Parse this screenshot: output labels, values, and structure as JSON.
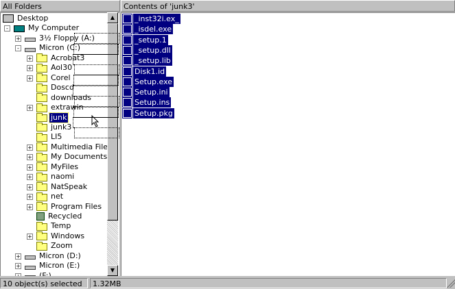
{
  "left_pane": {
    "header": "All Folders"
  },
  "right_pane": {
    "header": "Contents of 'junk3'"
  },
  "tree": {
    "items": [
      {
        "label": "Desktop",
        "icon": "desktop-icon",
        "level": 0,
        "expander": ""
      },
      {
        "label": "My Computer",
        "icon": "computer-icon",
        "level": 1,
        "expander": "-"
      },
      {
        "label": "3½ Floppy (A:)",
        "icon": "floppy-drive-icon",
        "level": 2,
        "expander": "+"
      },
      {
        "label": "Micron (C:)",
        "icon": "hard-drive-icon",
        "level": 2,
        "expander": "-"
      },
      {
        "label": "Acrobat3",
        "icon": "folder-icon",
        "level": 3,
        "expander": "+"
      },
      {
        "label": "Aol30",
        "icon": "folder-icon",
        "level": 3,
        "expander": "+"
      },
      {
        "label": "Corel",
        "icon": "folder-icon",
        "level": 3,
        "expander": "+"
      },
      {
        "label": "Doscd",
        "icon": "folder-icon",
        "level": 3,
        "expander": ""
      },
      {
        "label": "downloads",
        "icon": "folder-icon",
        "level": 3,
        "expander": ""
      },
      {
        "label": "extrawin",
        "icon": "folder-icon",
        "level": 3,
        "expander": "+"
      },
      {
        "label": "junk",
        "icon": "folder-icon",
        "level": 3,
        "expander": "",
        "selected": true
      },
      {
        "label": "junk3",
        "icon": "open-folder-icon",
        "level": 3,
        "expander": ""
      },
      {
        "label": "LI5",
        "icon": "folder-icon",
        "level": 3,
        "expander": ""
      },
      {
        "label": "Multimedia Files",
        "icon": "folder-icon",
        "level": 3,
        "expander": "+"
      },
      {
        "label": "My Documents",
        "icon": "folder-icon",
        "level": 3,
        "expander": "+"
      },
      {
        "label": "MyFiles",
        "icon": "folder-icon",
        "level": 3,
        "expander": "+"
      },
      {
        "label": "naomi",
        "icon": "folder-icon",
        "level": 3,
        "expander": "+"
      },
      {
        "label": "NatSpeak",
        "icon": "folder-icon",
        "level": 3,
        "expander": "+"
      },
      {
        "label": "net",
        "icon": "folder-icon",
        "level": 3,
        "expander": "+"
      },
      {
        "label": "Program Files",
        "icon": "folder-icon",
        "level": 3,
        "expander": "+"
      },
      {
        "label": "Recycled",
        "icon": "recycle-bin-icon",
        "level": 3,
        "expander": ""
      },
      {
        "label": "Temp",
        "icon": "folder-icon",
        "level": 3,
        "expander": ""
      },
      {
        "label": "Windows",
        "icon": "folder-icon",
        "level": 3,
        "expander": "+"
      },
      {
        "label": "Zoom",
        "icon": "folder-icon",
        "level": 3,
        "expander": ""
      },
      {
        "label": "Micron (D:)",
        "icon": "hard-drive-icon",
        "level": 2,
        "expander": "+"
      },
      {
        "label": "Micron (E:)",
        "icon": "hard-drive-icon",
        "level": 2,
        "expander": "+"
      },
      {
        "label": "(F:)",
        "icon": "hard-drive-icon",
        "level": 2,
        "expander": "+"
      }
    ]
  },
  "files": [
    {
      "name": "_inst32i.ex_"
    },
    {
      "name": "_isdel.exe"
    },
    {
      "name": "_setup.1"
    },
    {
      "name": "_setup.dll"
    },
    {
      "name": "_setup.lib"
    },
    {
      "name": "Disk1.id"
    },
    {
      "name": "Setup.exe"
    },
    {
      "name": "Setup.ini"
    },
    {
      "name": "Setup.ins"
    },
    {
      "name": "Setup.pkg"
    }
  ],
  "status": {
    "selected": "10 object(s) selected",
    "size": "1.32MB"
  },
  "colors": {
    "selection": "#000080",
    "chrome": "#c0c0c0"
  }
}
